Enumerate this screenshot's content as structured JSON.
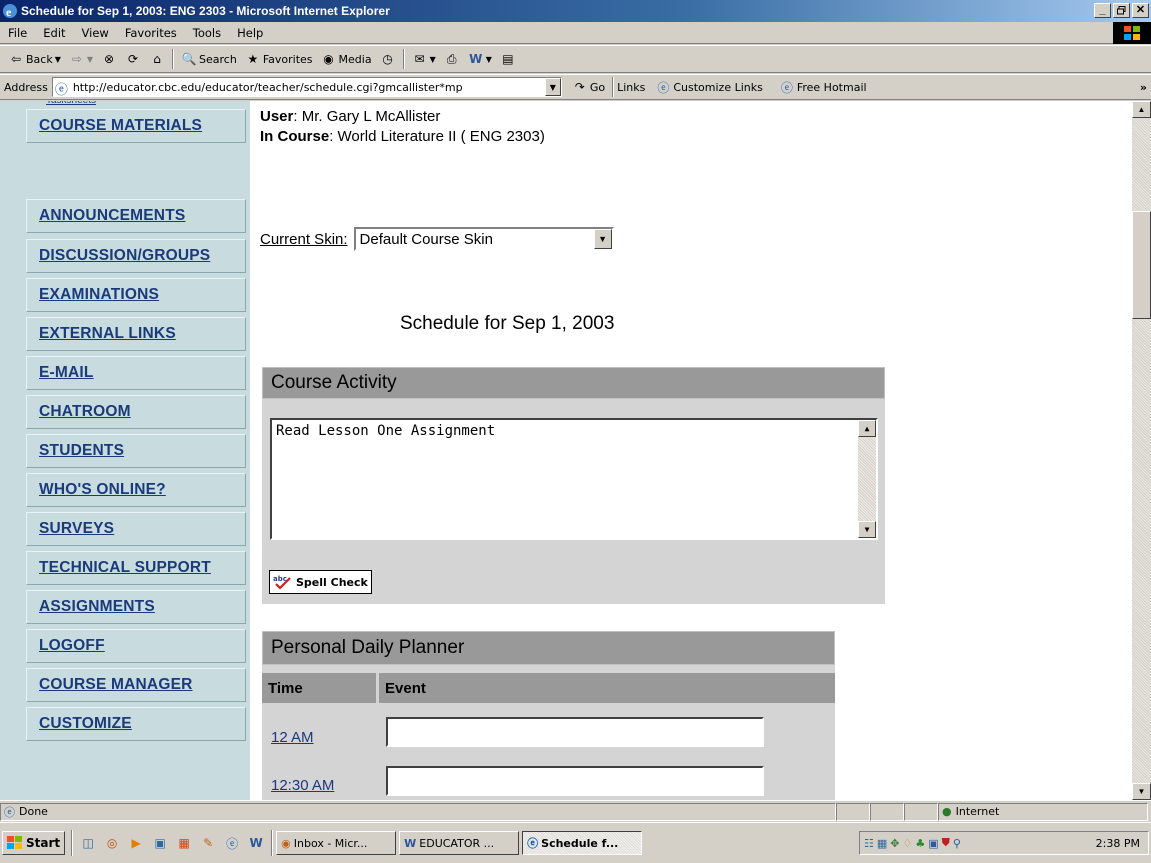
{
  "window": {
    "title": "Schedule for Sep 1, 2003: ENG 2303 - Microsoft Internet Explorer",
    "min": "_",
    "max": "▫",
    "close": "✕"
  },
  "menubar": {
    "items": [
      "File",
      "Edit",
      "View",
      "Favorites",
      "Tools",
      "Help"
    ]
  },
  "toolbar": {
    "back": "Back",
    "search": "Search",
    "favorites": "Favorites",
    "media": "Media"
  },
  "addressbar": {
    "label": "Address",
    "url": "http://educator.cbc.edu/educator/teacher/schedule.cgi?gmcallister*mp",
    "go": "Go",
    "links": "Links",
    "customize_links": "Customize Links",
    "free_hotmail": "Free Hotmail",
    "more": "»"
  },
  "nav": {
    "partial": "Tasksheets",
    "items": [
      "COURSE MATERIALS",
      "ANNOUNCEMENTS",
      "DISCUSSION/GROUPS",
      "EXAMINATIONS",
      "EXTERNAL LINKS",
      "E-MAIL",
      "CHATROOM",
      "STUDENTS",
      "WHO'S ONLINE?",
      "SURVEYS",
      "TECHNICAL SUPPORT",
      "ASSIGNMENTS",
      "LOGOFF",
      "COURSE MANAGER",
      "CUSTOMIZE"
    ]
  },
  "user": {
    "user_label": "User",
    "user_value": ": Mr. Gary L McAllister",
    "course_label": "In Course",
    "course_value": ": World Literature II ( ENG 2303)"
  },
  "skin": {
    "label": "Current Skin:",
    "selected": "Default Course Skin"
  },
  "schedule_title": "Schedule for Sep 1, 2003",
  "activity": {
    "header": "Course Activity",
    "text": "Read Lesson One Assignment",
    "spell_check": "Spell Check"
  },
  "planner": {
    "header": "Personal Daily Planner",
    "col_time": "Time",
    "col_event": "Event",
    "rows": [
      {
        "time": "12 AM",
        "event": ""
      },
      {
        "time": "12:30 AM",
        "event": ""
      }
    ]
  },
  "status": {
    "text": "Done",
    "zone": "Internet"
  },
  "taskbar": {
    "start": "Start",
    "tasks": [
      {
        "label": "Inbox - Micr..."
      },
      {
        "label": "EDUCATOR ..."
      },
      {
        "label": "Schedule f..."
      }
    ],
    "clock": "2:38 PM"
  }
}
